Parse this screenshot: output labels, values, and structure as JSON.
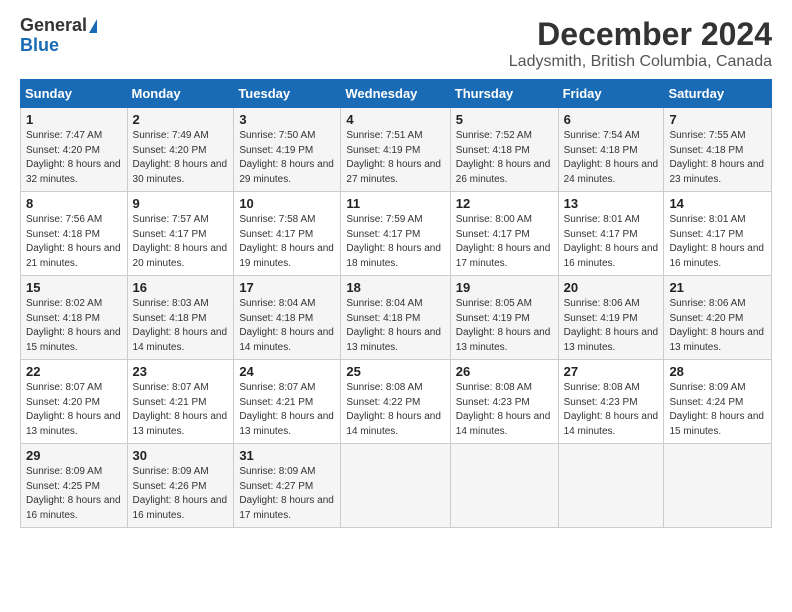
{
  "header": {
    "logo_general": "General",
    "logo_blue": "Blue",
    "month_title": "December 2024",
    "location": "Ladysmith, British Columbia, Canada"
  },
  "weekdays": [
    "Sunday",
    "Monday",
    "Tuesday",
    "Wednesday",
    "Thursday",
    "Friday",
    "Saturday"
  ],
  "weeks": [
    [
      {
        "day": "1",
        "sunrise": "7:47 AM",
        "sunset": "4:20 PM",
        "daylight": "8 hours and 32 minutes."
      },
      {
        "day": "2",
        "sunrise": "7:49 AM",
        "sunset": "4:20 PM",
        "daylight": "8 hours and 30 minutes."
      },
      {
        "day": "3",
        "sunrise": "7:50 AM",
        "sunset": "4:19 PM",
        "daylight": "8 hours and 29 minutes."
      },
      {
        "day": "4",
        "sunrise": "7:51 AM",
        "sunset": "4:19 PM",
        "daylight": "8 hours and 27 minutes."
      },
      {
        "day": "5",
        "sunrise": "7:52 AM",
        "sunset": "4:18 PM",
        "daylight": "8 hours and 26 minutes."
      },
      {
        "day": "6",
        "sunrise": "7:54 AM",
        "sunset": "4:18 PM",
        "daylight": "8 hours and 24 minutes."
      },
      {
        "day": "7",
        "sunrise": "7:55 AM",
        "sunset": "4:18 PM",
        "daylight": "8 hours and 23 minutes."
      }
    ],
    [
      {
        "day": "8",
        "sunrise": "7:56 AM",
        "sunset": "4:18 PM",
        "daylight": "8 hours and 21 minutes."
      },
      {
        "day": "9",
        "sunrise": "7:57 AM",
        "sunset": "4:17 PM",
        "daylight": "8 hours and 20 minutes."
      },
      {
        "day": "10",
        "sunrise": "7:58 AM",
        "sunset": "4:17 PM",
        "daylight": "8 hours and 19 minutes."
      },
      {
        "day": "11",
        "sunrise": "7:59 AM",
        "sunset": "4:17 PM",
        "daylight": "8 hours and 18 minutes."
      },
      {
        "day": "12",
        "sunrise": "8:00 AM",
        "sunset": "4:17 PM",
        "daylight": "8 hours and 17 minutes."
      },
      {
        "day": "13",
        "sunrise": "8:01 AM",
        "sunset": "4:17 PM",
        "daylight": "8 hours and 16 minutes."
      },
      {
        "day": "14",
        "sunrise": "8:01 AM",
        "sunset": "4:17 PM",
        "daylight": "8 hours and 16 minutes."
      }
    ],
    [
      {
        "day": "15",
        "sunrise": "8:02 AM",
        "sunset": "4:18 PM",
        "daylight": "8 hours and 15 minutes."
      },
      {
        "day": "16",
        "sunrise": "8:03 AM",
        "sunset": "4:18 PM",
        "daylight": "8 hours and 14 minutes."
      },
      {
        "day": "17",
        "sunrise": "8:04 AM",
        "sunset": "4:18 PM",
        "daylight": "8 hours and 14 minutes."
      },
      {
        "day": "18",
        "sunrise": "8:04 AM",
        "sunset": "4:18 PM",
        "daylight": "8 hours and 13 minutes."
      },
      {
        "day": "19",
        "sunrise": "8:05 AM",
        "sunset": "4:19 PM",
        "daylight": "8 hours and 13 minutes."
      },
      {
        "day": "20",
        "sunrise": "8:06 AM",
        "sunset": "4:19 PM",
        "daylight": "8 hours and 13 minutes."
      },
      {
        "day": "21",
        "sunrise": "8:06 AM",
        "sunset": "4:20 PM",
        "daylight": "8 hours and 13 minutes."
      }
    ],
    [
      {
        "day": "22",
        "sunrise": "8:07 AM",
        "sunset": "4:20 PM",
        "daylight": "8 hours and 13 minutes."
      },
      {
        "day": "23",
        "sunrise": "8:07 AM",
        "sunset": "4:21 PM",
        "daylight": "8 hours and 13 minutes."
      },
      {
        "day": "24",
        "sunrise": "8:07 AM",
        "sunset": "4:21 PM",
        "daylight": "8 hours and 13 minutes."
      },
      {
        "day": "25",
        "sunrise": "8:08 AM",
        "sunset": "4:22 PM",
        "daylight": "8 hours and 14 minutes."
      },
      {
        "day": "26",
        "sunrise": "8:08 AM",
        "sunset": "4:23 PM",
        "daylight": "8 hours and 14 minutes."
      },
      {
        "day": "27",
        "sunrise": "8:08 AM",
        "sunset": "4:23 PM",
        "daylight": "8 hours and 14 minutes."
      },
      {
        "day": "28",
        "sunrise": "8:09 AM",
        "sunset": "4:24 PM",
        "daylight": "8 hours and 15 minutes."
      }
    ],
    [
      {
        "day": "29",
        "sunrise": "8:09 AM",
        "sunset": "4:25 PM",
        "daylight": "8 hours and 16 minutes."
      },
      {
        "day": "30",
        "sunrise": "8:09 AM",
        "sunset": "4:26 PM",
        "daylight": "8 hours and 16 minutes."
      },
      {
        "day": "31",
        "sunrise": "8:09 AM",
        "sunset": "4:27 PM",
        "daylight": "8 hours and 17 minutes."
      },
      null,
      null,
      null,
      null
    ]
  ],
  "labels": {
    "sunrise_prefix": "Sunrise: ",
    "sunset_prefix": "Sunset: ",
    "daylight_prefix": "Daylight: "
  }
}
